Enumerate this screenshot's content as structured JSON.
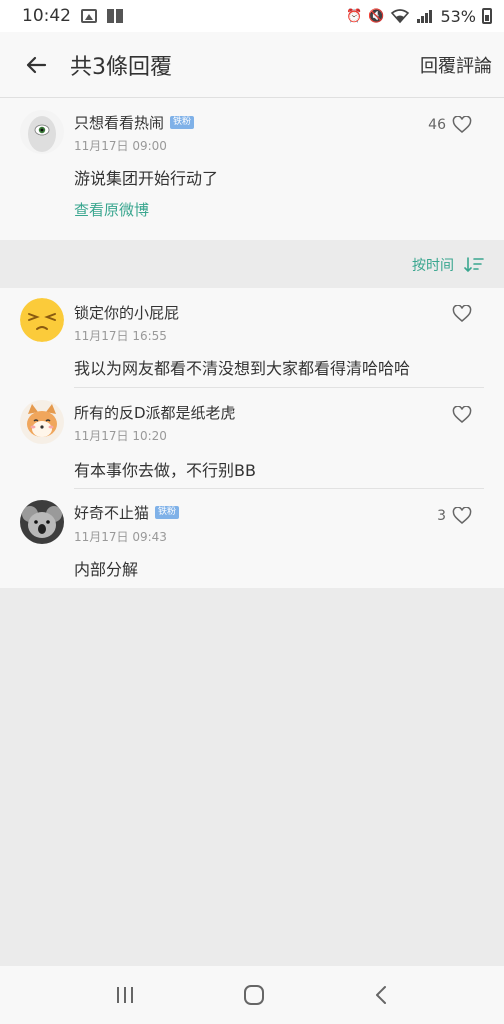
{
  "status": {
    "time": "10:42",
    "battery": "53%"
  },
  "header": {
    "title": "共3條回覆",
    "action": "回覆評論"
  },
  "post": {
    "author": "只想看看热闹",
    "badge": "铁粉",
    "time": "11月17日 09:00",
    "text": "游说集团开始行动了",
    "link": "查看原微博",
    "likes": "46"
  },
  "sort": {
    "label": "按时间"
  },
  "comments": [
    {
      "author": "锁定你的小屁屁",
      "badge": "",
      "time": "11月17日 16:55",
      "text": "我以为网友都看不清没想到大家都看得清哈哈哈",
      "likes": ""
    },
    {
      "author": "所有的反D派都是纸老虎",
      "badge": "",
      "time": "11月17日 10:20",
      "text": "有本事你去做，不行别BB",
      "likes": ""
    },
    {
      "author": "好奇不止猫",
      "badge": "铁粉",
      "time": "11月17日 09:43",
      "text": "内部分解",
      "likes": "3"
    }
  ],
  "colors": {
    "accent": "#3aa68f",
    "badge": "#7fb1e8"
  }
}
